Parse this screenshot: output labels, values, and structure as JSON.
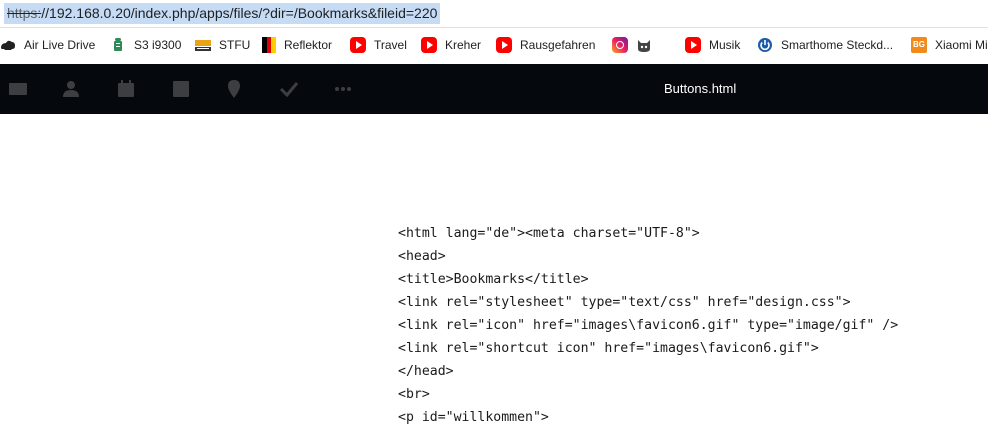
{
  "browser": {
    "url_scheme": "https:",
    "url_rest": "//192.168.0.20/index.php/apps/files/?dir=/Bookmarks&fileid=220",
    "bookmarks": [
      {
        "label": "Air Live Drive",
        "icon": "air-live-drive-icon"
      },
      {
        "label": "S3 i9300",
        "icon": "android-icon"
      },
      {
        "label": "STFU",
        "icon": "stfu-news-icon"
      },
      {
        "label": "Reflektor",
        "icon": "german-flag-icon"
      },
      {
        "label": "Travel",
        "icon": "youtube-icon"
      },
      {
        "label": "Kreher",
        "icon": "youtube-icon"
      },
      {
        "label": "Rausgefahren",
        "icon": "youtube-icon"
      },
      {
        "label": "",
        "icon": "instagram-icon"
      },
      {
        "label": "",
        "icon": "cat-icon"
      },
      {
        "label": "Musik",
        "icon": "youtube-icon"
      },
      {
        "label": "Smarthome Steckd...",
        "icon": "power-icon"
      },
      {
        "label": "Xiaomi Mi",
        "icon": "banggood-icon"
      }
    ],
    "colors": {
      "url_highlight": "#c6dcf5",
      "youtube_red": "#ff0000"
    }
  },
  "app": {
    "header_icons": [
      "mail-icon",
      "contacts-icon",
      "calendar-icon",
      "notes-icon",
      "maps-icon",
      "tasks-icon",
      "more-icon"
    ],
    "file_title": "Buttons.html",
    "header_color": "#05080c"
  },
  "viewer": {
    "lines": [
      "<html lang=\"de\"><meta charset=\"UTF-8\">",
      "<head>",
      "<title>Bookmarks</title>",
      "<link rel=\"stylesheet\" type=\"text/css\" href=\"design.css\">",
      "<link rel=\"icon\" href=\"images\\favicon6.gif\" type=\"image/gif\" />",
      "<link rel=\"shortcut icon\" href=\"images\\favicon6.gif\">",
      "</head>",
      "<br>",
      "<p id=\"willkommen\">"
    ]
  }
}
